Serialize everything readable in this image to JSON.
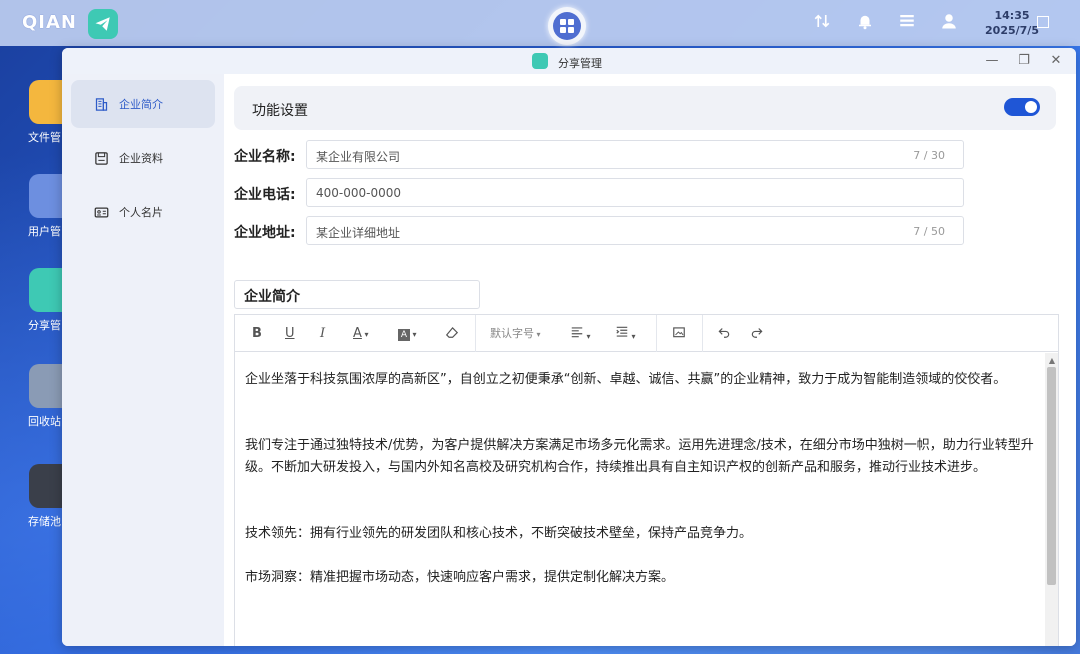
{
  "taskbar": {
    "logo": "QIAN",
    "clock_time": "14:35",
    "clock_date": "2025/7/5"
  },
  "desktop": {
    "icons": [
      {
        "label": "文件管",
        "color": "#f4b73e"
      },
      {
        "label": "用户管",
        "color": "#6d8fe0"
      },
      {
        "label": "分享管",
        "color": "#3ec9b4"
      },
      {
        "label": "回收站",
        "color": "#8a9bb5"
      },
      {
        "label": "存储池",
        "color": "#3a3f4a"
      }
    ]
  },
  "window": {
    "title": "分享管理",
    "sidebar": {
      "items": [
        {
          "label": "企业简介",
          "active": true
        },
        {
          "label": "企业资料",
          "active": false
        },
        {
          "label": "个人名片",
          "active": false
        }
      ]
    },
    "feature": {
      "label": "功能设置",
      "enabled": true
    },
    "form": {
      "company_name": {
        "label": "企业名称:",
        "placeholder": "某企业有限公司",
        "count": "7 / 30"
      },
      "company_phone": {
        "label": "企业电话:",
        "placeholder": "400-000-0000"
      },
      "company_address": {
        "label": "企业地址:",
        "placeholder": "某企业详细地址",
        "count": "7 / 50"
      }
    },
    "intro_title": "企业简介",
    "toolbar": {
      "bold": "B",
      "underline": "U",
      "italic": "I",
      "font_color": "A",
      "font_size": "默认字号"
    },
    "editor": {
      "paragraphs": [
        "企业坐落于科技氛围浓厚的高新区”，自创立之初便秉承“创新、卓越、诚信、共赢”的企业精神，致力于成为智能制造领域的佼佼者。",
        "",
        "",
        "我们专注于通过独特技术/优势，为客户提供解决方案满足市场多元化需求。运用先进理念/技术，在细分市场中独树一帜，助力行业转型升级。不断加大研发投入，与国内外知名高校及研究机构合作，持续推出具有自主知识产权的创新产品和服务，推动行业技术进步。",
        "",
        "",
        "技术领先：拥有行业领先的研发团队和核心技术，不断突破技术壁垒，保持产品竞争力。",
        "",
        "市场洞察：精准把握市场动态，快速响应客户需求，提供定制化解决方案。"
      ]
    },
    "colors": {
      "accent": "#1f56d6",
      "active_label": "#2f5cc8"
    }
  }
}
